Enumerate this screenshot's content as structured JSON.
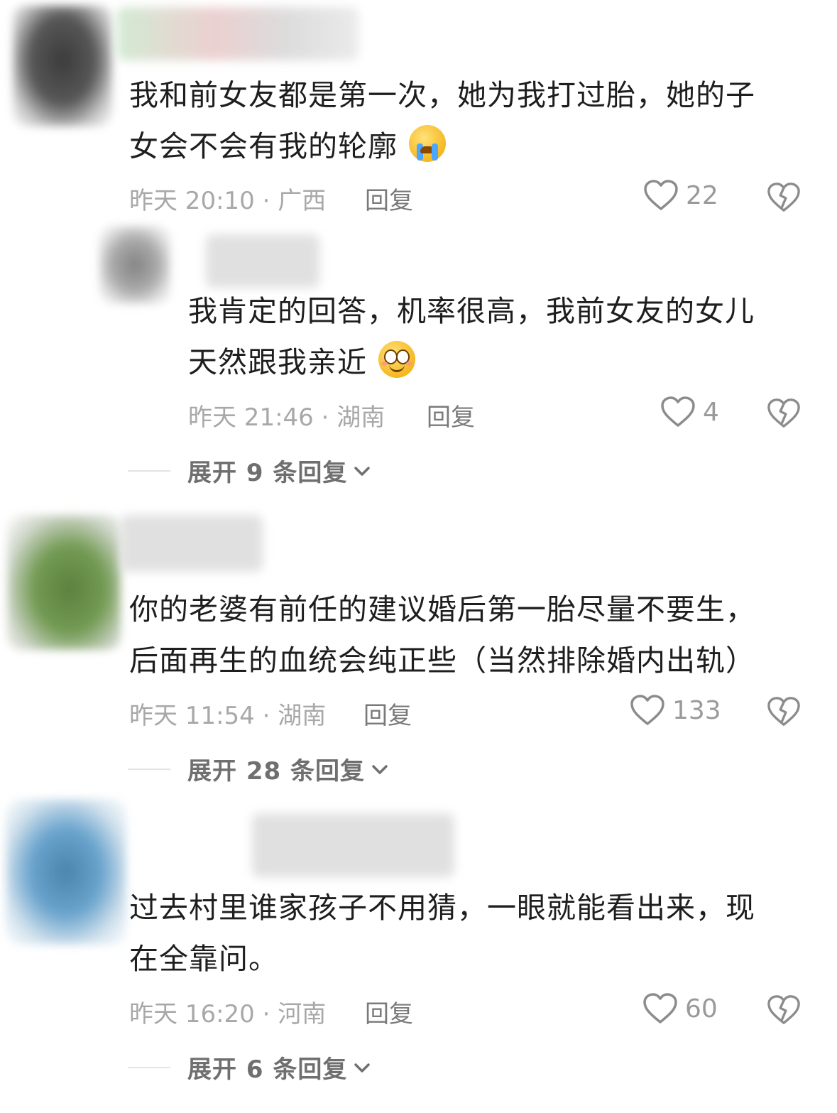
{
  "comments": [
    {
      "text_lines": [
        "我和前女友都是第一次，她为我打过胎，她的子",
        "女会不会有我的轮廓"
      ],
      "emoji": "loudly-crying-face",
      "time": "昨天 20:10",
      "location": "· 广西",
      "reply_label": "回复",
      "likes": "22"
    },
    {
      "text_lines": [
        "我肯定的回答，机率很高，我前女友的女儿",
        "天然跟我亲近"
      ],
      "emoji": "flushed-smiling-face",
      "time": "昨天 21:46",
      "location": "· 湖南",
      "reply_label": "回复",
      "likes": "4",
      "expand_label": "展开 9 条回复"
    },
    {
      "text_lines": [
        "你的老婆有前任的建议婚后第一胎尽量不要生，",
        "后面再生的血统会纯正些（当然排除婚内出轨）"
      ],
      "time": "昨天 11:54",
      "location": "· 湖南",
      "reply_label": "回复",
      "likes": "133",
      "expand_label": "展开 28 条回复"
    },
    {
      "text_lines": [
        "过去村里谁家孩子不用猜，一眼就能看出来，现",
        "在全靠问。"
      ],
      "time": "昨天 16:20",
      "location": "· 河南",
      "reply_label": "回复",
      "likes": "60",
      "expand_label": "展开 6 条回复"
    }
  ],
  "icons": {
    "like": "heart-outline-icon",
    "dislike": "broken-heart-icon",
    "expand": "chevron-down-icon"
  },
  "colors": {
    "text": "#1e1e1e",
    "meta": "#a8a8a8",
    "reply": "#7a7a7a",
    "icon": "#8c8c8c"
  }
}
